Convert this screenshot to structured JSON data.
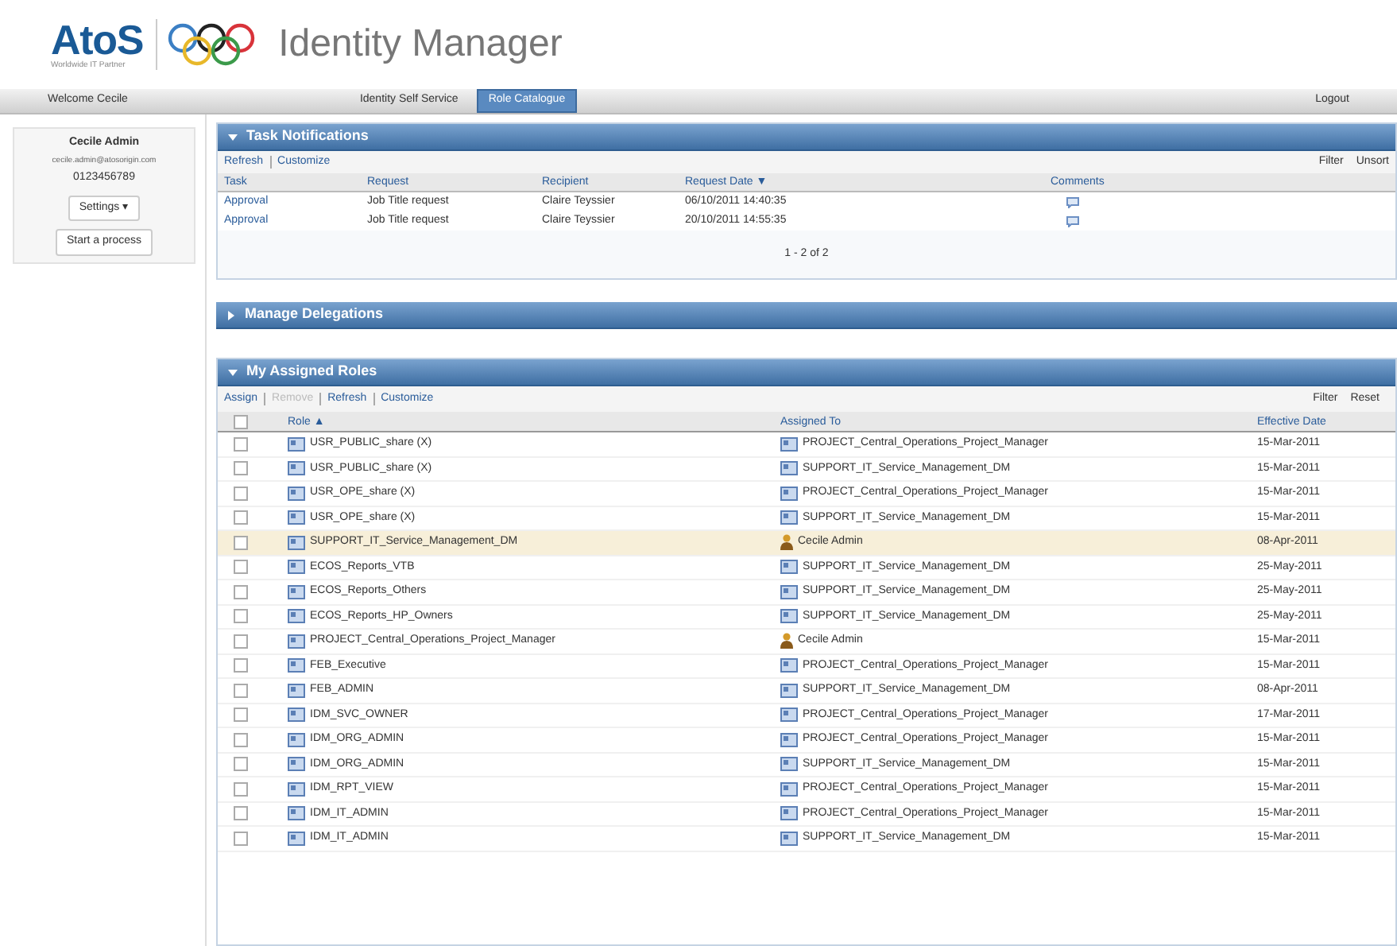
{
  "header": {
    "logo": "AtoS",
    "logo_tagline": "Worldwide IT Partner",
    "title": "Identity Manager"
  },
  "nav": {
    "welcome": "Welcome Cecile",
    "tabs": [
      {
        "label": "Identity Self Service",
        "selected": false
      },
      {
        "label": "Role Catalogue",
        "selected": true
      }
    ],
    "logout": "Logout"
  },
  "sidebar": {
    "name": "Cecile Admin",
    "email": "cecile.admin@atosorigin.com",
    "phone": "0123456789",
    "buttons": [
      "Settings ▾",
      "Start a process"
    ]
  },
  "tasks": {
    "title": "Task Notifications",
    "actions": [
      "Refresh",
      "Customize"
    ],
    "tools": [
      "Filter",
      "Unsort"
    ],
    "columns": [
      "Task",
      "Request",
      "Recipient",
      "Request Date ▼",
      "Comments"
    ],
    "rows": [
      [
        "Approval",
        "Job Title request",
        "Claire Teyssier",
        "06/10/2011 14:40:35"
      ],
      [
        "Approval",
        "Job Title request",
        "Claire Teyssier",
        "20/10/2011 14:55:35"
      ]
    ],
    "pagination": "1 - 2 of 2"
  },
  "delegations": {
    "title": "Manage Delegations",
    "expanded": false
  },
  "roles": {
    "title": "My Assigned Roles",
    "expanded": true,
    "actions": [
      {
        "label": "Assign",
        "disabled": false
      },
      {
        "label": "Remove",
        "disabled": true
      },
      {
        "label": "Refresh",
        "disabled": false
      },
      {
        "label": "Customize",
        "disabled": false
      }
    ],
    "tools": [
      "Filter",
      "Reset"
    ],
    "columns": [
      "Role ▲",
      "Assigned To",
      "Effective Date"
    ],
    "select_all_checked": false,
    "rows": [
      {
        "role": "USR_PUBLIC_share (X)",
        "assignee": "PROJECT_Central_Operations_Project_Manager",
        "kind": "group",
        "date": "15-Mar-2011",
        "checked": false,
        "selected": false
      },
      {
        "role": "USR_PUBLIC_share (X)",
        "assignee": "SUPPORT_IT_Service_Management_DM",
        "kind": "group",
        "date": "15-Mar-2011",
        "checked": false,
        "selected": false
      },
      {
        "role": "USR_OPE_share (X)",
        "assignee": "PROJECT_Central_Operations_Project_Manager",
        "kind": "group",
        "date": "15-Mar-2011",
        "checked": false,
        "selected": false
      },
      {
        "role": "USR_OPE_share (X)",
        "assignee": "SUPPORT_IT_Service_Management_DM",
        "kind": "group",
        "date": "15-Mar-2011",
        "checked": false,
        "selected": false
      },
      {
        "role": "SUPPORT_IT_Service_Management_DM",
        "assignee": "Cecile Admin",
        "kind": "user",
        "date": "08-Apr-2011",
        "checked": false,
        "selected": true
      },
      {
        "role": "ECOS_Reports_VTB",
        "assignee": "SUPPORT_IT_Service_Management_DM",
        "kind": "group",
        "date": "25-May-2011",
        "checked": false,
        "selected": false
      },
      {
        "role": "ECOS_Reports_Others",
        "assignee": "SUPPORT_IT_Service_Management_DM",
        "kind": "group",
        "date": "25-May-2011",
        "checked": false,
        "selected": false
      },
      {
        "role": "ECOS_Reports_HP_Owners",
        "assignee": "SUPPORT_IT_Service_Management_DM",
        "kind": "group",
        "date": "25-May-2011",
        "checked": false,
        "selected": false
      },
      {
        "role": "PROJECT_Central_Operations_Project_Manager",
        "assignee": "Cecile Admin",
        "kind": "user",
        "date": "15-Mar-2011",
        "checked": false,
        "selected": false
      },
      {
        "role": "FEB_Executive",
        "assignee": "PROJECT_Central_Operations_Project_Manager",
        "kind": "group",
        "date": "15-Mar-2011",
        "checked": false,
        "selected": false
      },
      {
        "role": "FEB_ADMIN",
        "assignee": "SUPPORT_IT_Service_Management_DM",
        "kind": "group",
        "date": "08-Apr-2011",
        "checked": false,
        "selected": false
      },
      {
        "role": "IDM_SVC_OWNER",
        "assignee": "PROJECT_Central_Operations_Project_Manager",
        "kind": "group",
        "date": "17-Mar-2011",
        "checked": false,
        "selected": false
      },
      {
        "role": "IDM_ORG_ADMIN",
        "assignee": "PROJECT_Central_Operations_Project_Manager",
        "kind": "group",
        "date": "15-Mar-2011",
        "checked": false,
        "selected": false
      },
      {
        "role": "IDM_ORG_ADMIN",
        "assignee": "SUPPORT_IT_Service_Management_DM",
        "kind": "group",
        "date": "15-Mar-2011",
        "checked": false,
        "selected": false
      },
      {
        "role": "IDM_RPT_VIEW",
        "assignee": "PROJECT_Central_Operations_Project_Manager",
        "kind": "group",
        "date": "15-Mar-2011",
        "checked": false,
        "selected": false
      },
      {
        "role": "IDM_IT_ADMIN",
        "assignee": "PROJECT_Central_Operations_Project_Manager",
        "kind": "group",
        "date": "15-Mar-2011",
        "checked": false,
        "selected": false
      },
      {
        "role": "IDM_IT_ADMIN",
        "assignee": "SUPPORT_IT_Service_Management_DM",
        "kind": "group",
        "date": "15-Mar-2011",
        "checked": false,
        "selected": false
      }
    ]
  }
}
